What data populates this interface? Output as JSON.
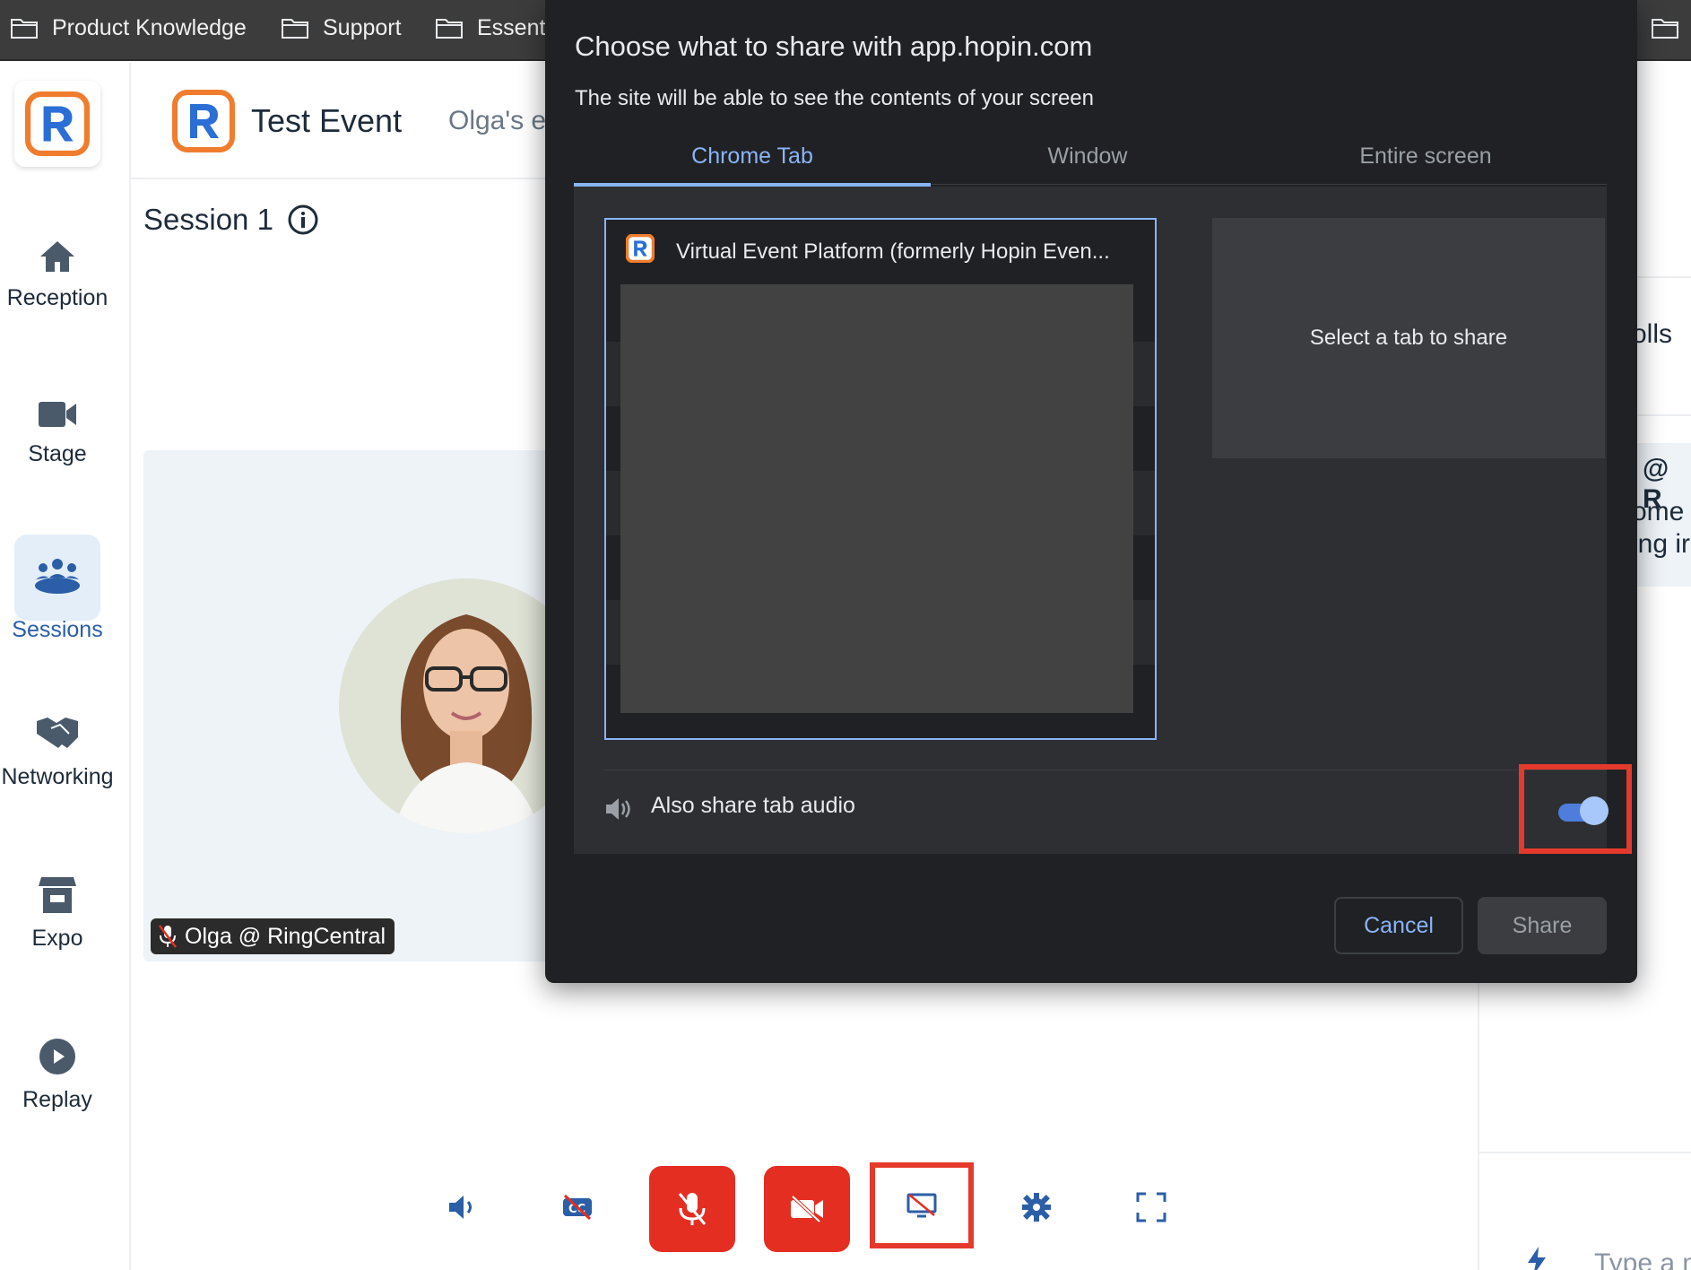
{
  "bookmarks": [
    {
      "label": "Product Knowledge"
    },
    {
      "label": "Support"
    },
    {
      "label": "Essent"
    }
  ],
  "header": {
    "event_title": "Test Event",
    "subtitle": "Olga's e"
  },
  "sidebar": {
    "items": [
      {
        "label": "Reception"
      },
      {
        "label": "Stage"
      },
      {
        "label": "Sessions"
      },
      {
        "label": "Networking"
      },
      {
        "label": "Expo"
      },
      {
        "label": "Replay"
      }
    ],
    "active_color": "#2b5ea7"
  },
  "main": {
    "session_title": "Session 1",
    "participant_name": "Olga @ RingCentral"
  },
  "right_panel": {
    "tab_fragment": "olls",
    "author_fragment": "@ R",
    "msg_line1": "ome",
    "msg_line2": "ing ir",
    "chat_placeholder": "Type a m"
  },
  "dialog": {
    "title": "Choose what to share with app.hopin.com",
    "subtitle": "The site will be able to see the contents of your screen",
    "tabs": [
      {
        "label": "Chrome Tab",
        "active": true
      },
      {
        "label": "Window",
        "active": false
      },
      {
        "label": "Entire screen",
        "active": false
      }
    ],
    "tab_entry": "Virtual Event Platform (formerly Hopin Even...",
    "preview_hint": "Select a tab to share",
    "audio_label": "Also share tab audio",
    "audio_enabled": true,
    "cancel_label": "Cancel",
    "share_label": "Share"
  },
  "colors": {
    "accent_blue": "#8ab4f8",
    "brand_orange": "#f07d2e",
    "brand_blue": "#2b6fd6",
    "control_red": "#e42e22",
    "highlight_red": "#e53a2b"
  }
}
